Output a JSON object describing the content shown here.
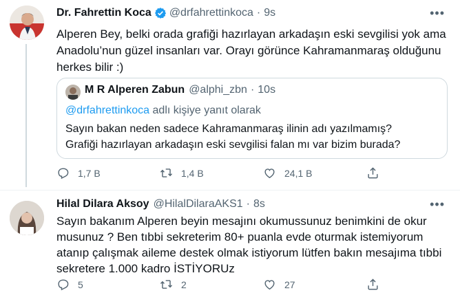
{
  "tweet": {
    "name": "Dr. Fahrettin Koca",
    "handle": "@drfahrettinkoca",
    "time": "9s",
    "text": "Alperen Bey, belki orada grafiği hazırlayan arkadaşın eski sevgilisi yok ama\nAnadolu’nun güzel insanları var. Orayı görünce Kahramanmaraş olduğunu\nherkes bilir :)",
    "quote": {
      "name": "M R Alperen Zabun",
      "handle": "@alphi_zbn",
      "time": "10s",
      "reply_to_handle": "@drfahrettinkoca",
      "reply_to_suffix": " adlı kişiye yanıt olarak",
      "text": "Sayın bakan neden sadece Kahramanmaraş ilinin adı yazılmamış?\nGrafiği hazırlayan arkadaşın eski sevgilisi falan mı var bizim burada?"
    },
    "replies": "1,7 B",
    "retweets": "1,4 B",
    "likes": "24,1 B"
  },
  "reply": {
    "name": "Hilal Dilara Aksoy",
    "handle": "@HilalDilaraAKS1",
    "time": "8s",
    "text": "Sayın bakanım Alperen beyin mesajını okumussunuz benimkini de okur\nmusunuz ? Ben tıbbi sekreterim 80+ puanla evde oturmak istemiyorum\natanıp çalışmak aileme destek olmak istiyorum lütfen bakın mesajıma tıbbi\nsekretere 1.000 kadro İSTİYORUz",
    "replies": "5",
    "retweets": "2",
    "likes": "27"
  },
  "icons": {
    "reply": "reply-icon",
    "retweet": "retweet-icon",
    "like": "heart-icon",
    "share": "share-icon",
    "verified": "verified-badge-icon",
    "more": "more-icon"
  },
  "colors": {
    "accent": "#1d9bf0",
    "secondary_text": "#536471",
    "border": "#cfd9de"
  }
}
